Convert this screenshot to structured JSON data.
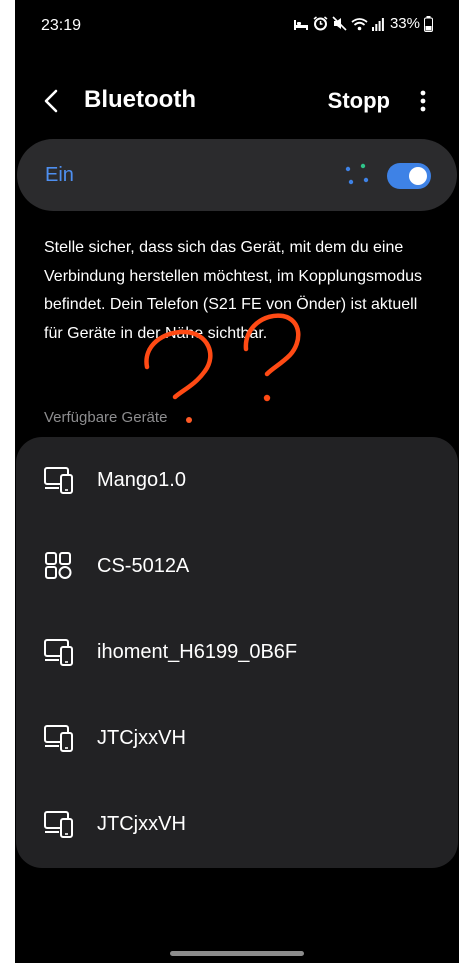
{
  "status_bar": {
    "time": "23:19",
    "battery_percent": "33%",
    "icons": [
      "bed-icon",
      "alarm-icon",
      "mute-icon",
      "wifi-icon",
      "signal-icon",
      "battery-icon"
    ]
  },
  "header": {
    "title": "Bluetooth",
    "stop_label": "Stopp"
  },
  "toggle": {
    "label": "Ein",
    "state": "on",
    "accent_color": "#3e82e6"
  },
  "info_text": "Stelle sicher, dass sich das Gerät, mit dem du eine Verbindung herstellen möchtest, im Kopplungsmodus befindet. Dein Telefon (S21 FE von Önder) ist aktuell für Geräte in der Nähe sichtbar.",
  "available_devices": {
    "title": "Verfügbare Geräte",
    "items": [
      {
        "name": "Mango1.0",
        "icon": "devices-icon"
      },
      {
        "name": "CS-5012A",
        "icon": "device-grid-icon"
      },
      {
        "name": "ihoment_H6199_0B6F",
        "icon": "devices-icon"
      },
      {
        "name": "JTCjxxVH",
        "icon": "devices-icon"
      },
      {
        "name": "JTCjxxVH",
        "icon": "devices-icon"
      }
    ]
  },
  "annotation_color": "#ff4a14"
}
